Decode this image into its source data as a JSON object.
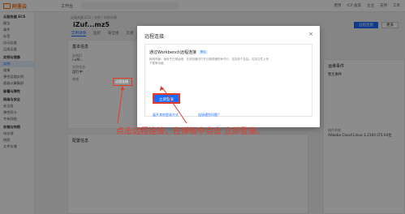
{
  "topbar": {
    "logo": "阿里云",
    "workbench": "工作台",
    "links": [
      "费用",
      "ICP 备案",
      "企业",
      "支持",
      "工单"
    ]
  },
  "sidebar": {
    "items": [
      {
        "label": "云服务器 ECS",
        "type": "group"
      },
      {
        "label": "概览",
        "type": "item"
      },
      {
        "label": "事件",
        "type": "item"
      },
      {
        "label": "标签",
        "type": "item"
      },
      {
        "label": "自动运维",
        "type": "item"
      },
      {
        "label": "运维运维",
        "type": "item"
      },
      {
        "label": "实例与镜像",
        "type": "group"
      },
      {
        "label": "实例",
        "type": "active"
      },
      {
        "label": "镜像",
        "type": "item"
      },
      {
        "label": "弹性容器实例",
        "type": "item"
      },
      {
        "label": "超级计算集群",
        "type": "item"
      },
      {
        "label": "部署与弹性",
        "type": "group"
      },
      {
        "label": "网络与安全",
        "type": "group"
      },
      {
        "label": "安全组",
        "type": "item"
      },
      {
        "label": "弹性网卡",
        "type": "item"
      },
      {
        "label": "专有网络",
        "type": "item"
      },
      {
        "label": "存储与快照",
        "type": "group"
      },
      {
        "label": "块存储",
        "type": "item"
      },
      {
        "label": "快照",
        "type": "item"
      },
      {
        "label": "文件存储",
        "type": "item"
      }
    ]
  },
  "main": {
    "breadcrumb": "云服务器 ECS / 实例 / 实例详情",
    "title": "iZuf...mz5",
    "tabs": [
      "实例详情",
      "监控",
      "安全组",
      "云盘",
      "快照",
      "弹性网卡"
    ],
    "buttons": [
      "远程连接",
      "更多"
    ],
    "basic_info_title": "基本信息",
    "instance_id_label": "实例ID",
    "remote_link": "远程连接",
    "status_label": "实例状态",
    "status_value": "运行中",
    "region_label": "地域",
    "config_title": "配置信息",
    "right_title": "运维事件",
    "right_value": "暂无事件",
    "os_label": "操作系统",
    "os_value": "Alibaba Cloud Linux 3.2104 LTS 64位"
  },
  "modal": {
    "title": "远程连接",
    "close": "×",
    "card_title": "通过Workbench远程连接",
    "tag": "默认",
    "description": "使用场景：适用于日常运维，在浏览器中打开云服务器的命令行，支持多个会话，支持文件上传下载等功能。",
    "login_button": "立即登录",
    "more_link": "展开其他登录方式",
    "fail_link": "连接遇到问题?"
  },
  "annotation": {
    "text": "点击远程连接，在弹框中点击 立即登录。",
    "color": "#e43b2b"
  },
  "colors": {
    "accent": "#1a6bff",
    "brand": "#ff6a00",
    "annotation": "#e43b2b"
  }
}
